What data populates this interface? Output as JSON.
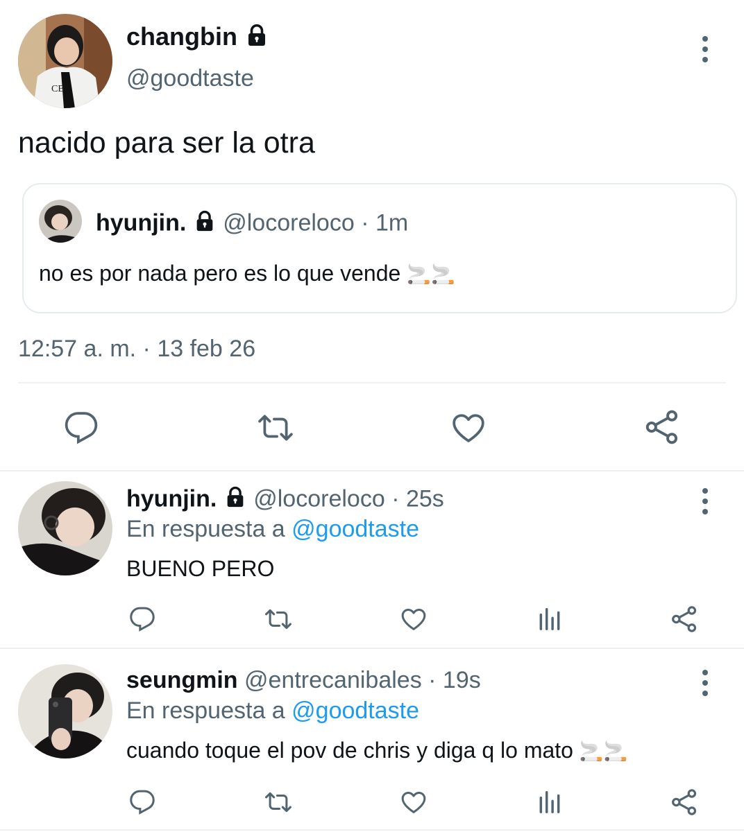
{
  "main_tweet": {
    "display_name": "changbin",
    "handle": "@goodtaste",
    "text": "nacido para ser la otra",
    "timestamp": "12:57 a. m. · 13 feb 26",
    "quoted": {
      "display_name": "hyunjin.",
      "handle": "@locoreloco",
      "time": "· 1m",
      "text": "no es por nada pero es lo que vende",
      "emoji": "🚬🚬"
    }
  },
  "replies": [
    {
      "display_name": "hyunjin.",
      "handle": "@locoreloco",
      "time": "· 25s",
      "reply_prefix": "En respuesta a",
      "reply_to": "@goodtaste",
      "text": "BUENO PERO",
      "emoji": ""
    },
    {
      "display_name": "seungmin",
      "handle": "@entrecanibales",
      "time": "· 19s",
      "reply_prefix": "En respuesta a",
      "reply_to": "@goodtaste",
      "text": "cuando toque el pov de chris y diga q lo mato",
      "emoji": "🚬🚬"
    }
  ],
  "colors": {
    "text": "#0f1419",
    "muted": "#536471",
    "link": "#1d9bf0",
    "divider": "#eef1f4"
  },
  "icons": [
    "lock-icon",
    "more-options-icon",
    "reply-icon",
    "retweet-icon",
    "like-icon",
    "share-icon",
    "analytics-icon"
  ]
}
